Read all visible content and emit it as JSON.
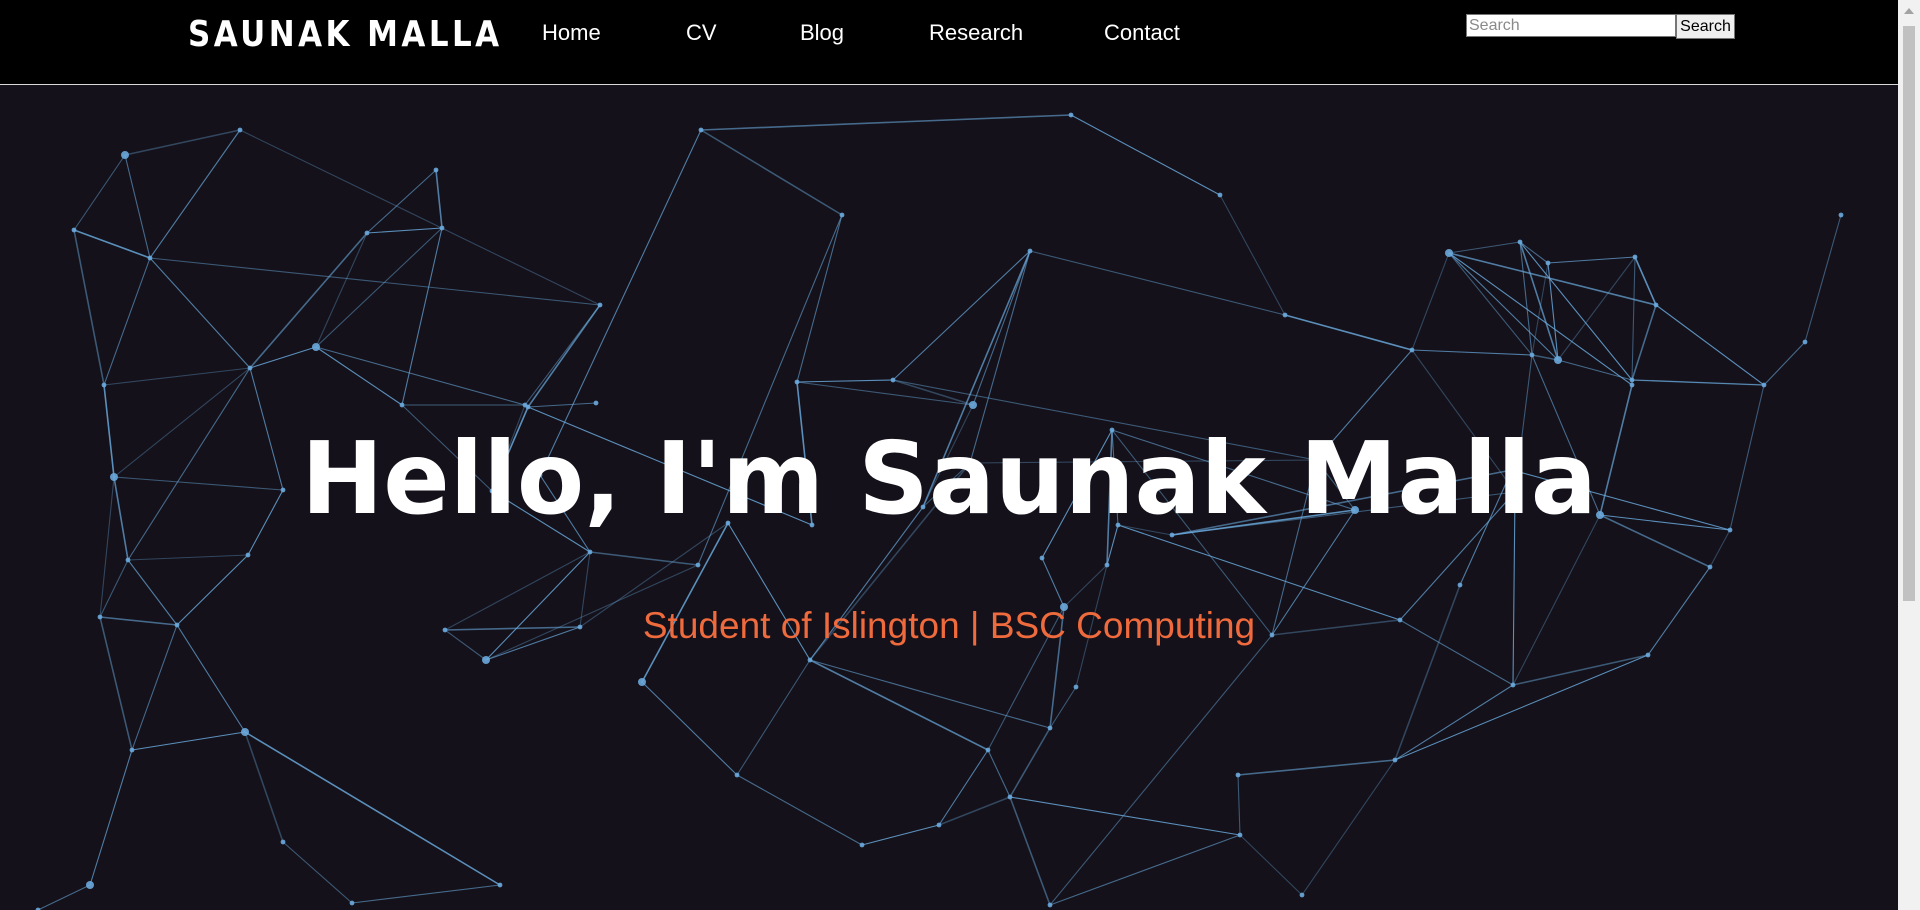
{
  "brand": {
    "name": "SAUNAK MALLA"
  },
  "nav": {
    "items": [
      {
        "label": "Home"
      },
      {
        "label": "CV"
      },
      {
        "label": "Blog"
      },
      {
        "label": "Research"
      },
      {
        "label": "Contact"
      }
    ]
  },
  "search": {
    "placeholder": "Search",
    "value": "",
    "button_label": "Search"
  },
  "hero": {
    "title": "Hello, I'm Saunak Malla",
    "subtitle": "Student of Islington | BSC Computing"
  },
  "colors": {
    "navbar_bg": "#000000",
    "hero_bg": "#14111a",
    "network_line": "#6aa9dc",
    "subtitle": "#ef6a3c"
  },
  "icons": {
    "background": "particle-network-graphic",
    "scroll_up": "scroll-up-arrow-icon"
  }
}
